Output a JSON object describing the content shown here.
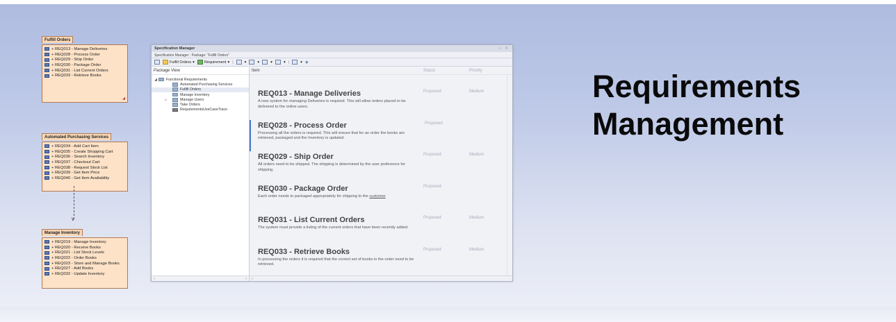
{
  "packages": [
    {
      "title": "Fulfill Orders",
      "items": [
        "+ REQ013 - Manage Deliveries",
        "+ REQ028 - Process Order",
        "+ REQ029 - Ship Order",
        "+ REQ030 - Package Order",
        "+ REQ031 - List Current Orders",
        "+ REQ033 - Retrieve Books"
      ]
    },
    {
      "title": "Automated Purchasing Services",
      "items": [
        "+ REQ034 - Add Cart Item",
        "+ REQ035 - Create Shopping Cart",
        "+ REQ036 - Search Inventory",
        "+ REQ037 - Checkout Cart",
        "+ REQ038 - Request Stock List",
        "+ REQ039 - Get Item Price",
        "+ REQ040 - Get Item Availability"
      ]
    },
    {
      "title": "Manage Inventory",
      "items": [
        "+ REQ019 - Manage Inventory",
        "+ REQ020 - Receive Books",
        "+ REQ021 - List Stock Levels",
        "+ REQ022 - Order Books",
        "+ REQ023 - Store and Manage Books",
        "+ REQ027 - Add Books",
        "+ REQ032 - Update Inventory"
      ]
    }
  ],
  "window": {
    "title": "Specification Manager",
    "breadcrumb": "Specification Manager :  Package: \"Fulfill Orders\"",
    "toolbar": {
      "package": "Fulfill Orders",
      "type": "Requirement"
    },
    "left_header": "Package View",
    "tree": [
      {
        "label": "Functional Requirements",
        "level": 0
      },
      {
        "label": "Automated Purchasing Services",
        "level": 1
      },
      {
        "label": "Fulfill Orders",
        "level": 1
      },
      {
        "label": "Manage Inventory",
        "level": 1
      },
      {
        "label": "Manage Users",
        "level": 1
      },
      {
        "label": "Take Orders",
        "level": 1
      },
      {
        "label": "RequirementsUseCaseTrace",
        "level": 1
      }
    ],
    "columns": {
      "item": "Item",
      "status": "Status",
      "priority": "Priority"
    },
    "items": [
      {
        "title": "REQ013 - Manage Deliveries",
        "desc": "A new system for managing Deliveries is required. This will allow orders placed to be delivered to the online users.",
        "status": "Proposed",
        "priority": "Medium"
      },
      {
        "title": "REQ028 - Process Order",
        "desc": "Processing all the orders is required. This will ensure that for an order the books are retrieved, packaged and the Inventory is updated.",
        "status": "Proposed",
        "priority": ""
      },
      {
        "title": "REQ029 - Ship Order",
        "desc": "All orders need to be shipped.  The shipping is determined by the user preference for shipping.",
        "status": "Proposed",
        "priority": "Medium"
      },
      {
        "title": "REQ030 - Package Order",
        "desc": "Each order needs to packaged appropriately for shipping to the",
        "desc_link": "customer",
        "status": "Proposed",
        "priority": ""
      },
      {
        "title": "REQ031 - List Current Orders",
        "desc": "The system must provide a listing of the current orders that have been recently added.",
        "status": "Proposed",
        "priority": "Medium"
      },
      {
        "title": "REQ033 - Retrieve Books",
        "desc": "In processing the orders it is required that the correct set of books in the order need to be retrieved.",
        "status": "Proposed",
        "priority": "Medium"
      }
    ]
  },
  "hero": {
    "line1": "Requirements",
    "line2": "Management"
  }
}
